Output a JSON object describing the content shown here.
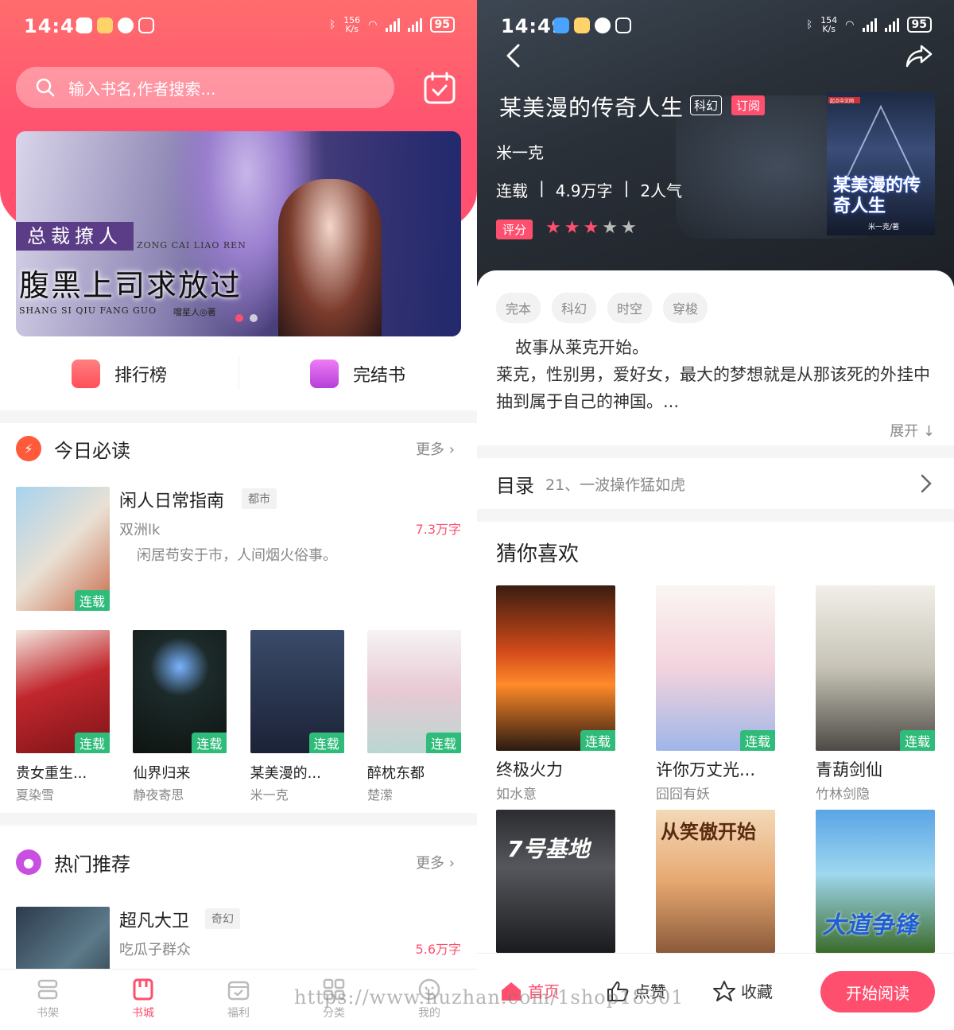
{
  "left": {
    "status": {
      "time": "14:48",
      "speed": "156\nK/s",
      "battery": "95"
    },
    "search": {
      "placeholder": "输入书名,作者搜索..."
    },
    "banner": {
      "tag": "总裁撩人",
      "tag_pinyin": "ZONG CAI LIAO REN",
      "title": "腹黑上司求放过",
      "title_pinyin": "SHANG SI QIU FANG GUO",
      "author": "噹星人◎著"
    },
    "quick": [
      {
        "label": "排行榜",
        "color": "#ff5a5a"
      },
      {
        "label": "完结书",
        "color": "#d24fe0"
      }
    ],
    "today": {
      "title": "今日必读",
      "more": "更多",
      "featured": {
        "title": "闲人日常指南",
        "tag": "都市",
        "author": "双洲lk",
        "words": "7.3万字",
        "desc": "闲居苟安于市，人间烟火俗事。",
        "badge": "连载"
      },
      "books": [
        {
          "title": "贵女重生...",
          "author": "夏染雪",
          "badge": "连载"
        },
        {
          "title": "仙界归来",
          "author": "静夜寄思",
          "badge": "连载"
        },
        {
          "title": "某美漫的...",
          "author": "米一克",
          "badge": "连载"
        },
        {
          "title": "醉枕东都",
          "author": "楚潆",
          "badge": "连载"
        }
      ]
    },
    "hot": {
      "title": "热门推荐",
      "more": "更多",
      "featured": {
        "title": "超凡大卫",
        "tag": "奇幻",
        "author": "吃瓜子群众",
        "words": "5.6万字"
      }
    },
    "tabs": [
      {
        "label": "书架",
        "icon": "bookshelf-icon"
      },
      {
        "label": "书城",
        "icon": "bookstore-icon"
      },
      {
        "label": "福利",
        "icon": "calendar-icon"
      },
      {
        "label": "分类",
        "icon": "grid-icon"
      },
      {
        "label": "我的",
        "icon": "user-icon"
      }
    ]
  },
  "right": {
    "status": {
      "time": "14:49",
      "speed": "154\nK/s",
      "battery": "95"
    },
    "book": {
      "title": "某美漫的传奇人生",
      "genre": "科幻",
      "subscribe": "订阅",
      "author": "米一克",
      "status": "连载",
      "words": "4.9万字",
      "popularity": "2人气",
      "rating_label": "评分",
      "rating": 3,
      "rating_max": 5,
      "cover_title": "某美漫的传奇人生",
      "cover_author": "米一克/著",
      "cover_publisher": "起点中文网"
    },
    "tags": [
      "完本",
      "科幻",
      "时空",
      "穿梭"
    ],
    "desc": "故事从莱克开始。\n莱克，性别男，爱好女，最大的梦想就是从那该死的外挂中抽到属于自己的神国。...",
    "expand": "展开 ↓",
    "toc": {
      "title": "目录",
      "chapter": "21、一波操作猛如虎"
    },
    "like": {
      "title": "猜你喜欢",
      "books": [
        {
          "title": "终极火力",
          "author": "如水意",
          "badge": "连载"
        },
        {
          "title": "许你万丈光...",
          "author": "囧囧有妖",
          "badge": "连载"
        },
        {
          "title": "青葫剑仙",
          "author": "竹林剑隐",
          "badge": "连载"
        }
      ],
      "more_covers": [
        "7号基地",
        "从笑傲开始",
        "大道争锋"
      ]
    },
    "bottom": {
      "home": "首页",
      "like": "点赞",
      "fav": "收藏",
      "read": "开始阅读"
    }
  },
  "watermark": "https://www.huzhan.com/1shop18301",
  "colors": {
    "accent": "#ff4f6e",
    "badge": "#2fbc7a"
  }
}
